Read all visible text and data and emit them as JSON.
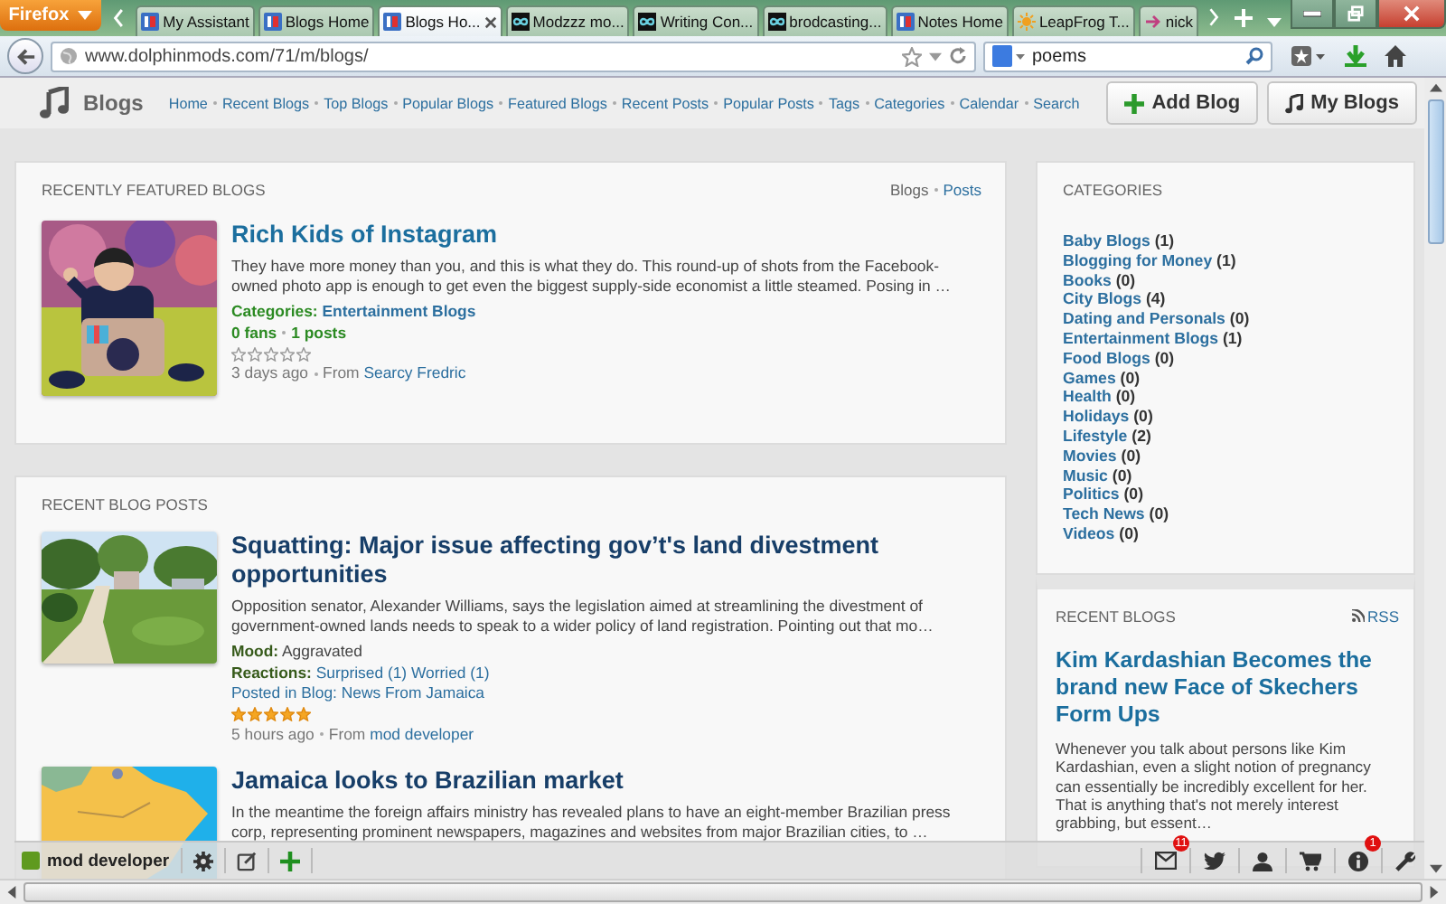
{
  "browser": {
    "menu_button": "Firefox",
    "tabs": [
      {
        "title": "My Assistant",
        "kind": "blog",
        "selected": false
      },
      {
        "title": "Blogs Home",
        "kind": "blog",
        "selected": false
      },
      {
        "title": "Blogs Ho...",
        "kind": "blog",
        "selected": true
      },
      {
        "title": "Modzzz mo...",
        "kind": "loop",
        "selected": false
      },
      {
        "title": "Writing Con...",
        "kind": "loop",
        "selected": false
      },
      {
        "title": "brodcasting...",
        "kind": "loop",
        "selected": false
      },
      {
        "title": "Notes Home",
        "kind": "blog",
        "selected": false
      },
      {
        "title": "LeapFrog T...",
        "kind": "sun",
        "selected": false
      },
      {
        "title": "nick",
        "kind": "arrow",
        "selected": false
      }
    ],
    "address": "www.dolphinmods.com/71/m/blogs/",
    "search": "poems"
  },
  "header": {
    "title": "Blogs",
    "nav": [
      "Home",
      "Recent Blogs",
      "Top Blogs",
      "Popular Blogs",
      "Featured Blogs",
      "Recent Posts",
      "Popular Posts",
      "Tags",
      "Categories",
      "Calendar",
      "Search"
    ],
    "buttons": [
      {
        "label": "Add Blog",
        "kind": "add"
      },
      {
        "label": "My Blogs",
        "kind": "music"
      }
    ]
  },
  "featured": {
    "title": "RECENTLY FEATURED BLOGS",
    "tabs": [
      {
        "label": "Blogs",
        "selected": true
      },
      {
        "label": "Posts",
        "selected": false
      }
    ],
    "items": [
      {
        "title": "Rich Kids of Instagram",
        "excerpt": "They have more money than you, and this is what they do. This round-up of shots from the Facebook-owned photo app is enough to get even the biggest supply-side economist a little steamed. Posing in …",
        "categories_label": "Categories:",
        "category": "Entertainment Blogs",
        "fans": "0 fans",
        "posts": "1 posts",
        "stars": 0,
        "time": "3 days ago",
        "from_label": "From",
        "author": "Searcy Fredric"
      }
    ]
  },
  "recent_posts": {
    "title": "RECENT BLOG POSTS",
    "posts": [
      {
        "title": "Squatting: Major issue affecting gov’t's land divestment opportunities",
        "excerpt": "Opposition senator, Alexander Williams, says the legislation aimed at streamlining the divestment of government-owned lands needs to speak to a wider policy of land registration. Pointing out that mo…",
        "mood_label": "Mood:",
        "mood": "Aggravated",
        "reactions_label": "Reactions:",
        "reactions": [
          "Surprised (1)",
          "Worried (1)"
        ],
        "posted_in": "Posted in Blog: News From Jamaica",
        "stars": 5,
        "time": "5 hours ago",
        "from_label": "From",
        "author": "mod developer"
      },
      {
        "title": "Jamaica looks to Brazilian market",
        "excerpt": "In the meantime the foreign affairs ministry has revealed plans to have an eight-member Brazilian press corp, representing prominent newspapers, magazines and websites from major Brazilian cities, to …"
      }
    ]
  },
  "categories": {
    "title": "CATEGORIES",
    "items": [
      {
        "name": "Baby Blogs",
        "count": "(1)"
      },
      {
        "name": "Blogging for Money",
        "count": "(1)"
      },
      {
        "name": "Books",
        "count": "(0)"
      },
      {
        "name": "City Blogs",
        "count": "(4)"
      },
      {
        "name": "Dating and Personals",
        "count": "(0)"
      },
      {
        "name": "Entertainment Blogs",
        "count": "(1)"
      },
      {
        "name": "Food Blogs",
        "count": "(0)"
      },
      {
        "name": "Games",
        "count": "(0)"
      },
      {
        "name": "Health",
        "count": "(0)"
      },
      {
        "name": "Holidays",
        "count": "(0)"
      },
      {
        "name": "Lifestyle",
        "count": "(2)"
      },
      {
        "name": "Movies",
        "count": "(0)"
      },
      {
        "name": "Music",
        "count": "(0)"
      },
      {
        "name": "Politics",
        "count": "(0)"
      },
      {
        "name": "Tech News",
        "count": "(0)"
      },
      {
        "name": "Videos",
        "count": "(0)"
      }
    ]
  },
  "recent_blogs": {
    "title": "RECENT BLOGS",
    "rss": "RSS",
    "items": [
      {
        "title": "Kim Kardashian Becomes the brand new Face of Skechers Form Ups",
        "excerpt": "Whenever you talk about persons like Kim Kardashian, even a slight notion of pregnancy can essentially be incredibly excellent for her. That is anything that's not merely interest grabbing, but essent…"
      }
    ]
  },
  "toolbar": {
    "user": "mod developer",
    "left_icons": [
      {
        "kind": "gear"
      },
      {
        "kind": "edit"
      },
      {
        "kind": "plus"
      }
    ],
    "right_icons": [
      {
        "kind": "mail",
        "badge": "11"
      },
      {
        "kind": "bird"
      },
      {
        "kind": "user"
      },
      {
        "kind": "cart"
      },
      {
        "kind": "info",
        "badge": "1"
      },
      {
        "kind": "wrench"
      }
    ]
  }
}
